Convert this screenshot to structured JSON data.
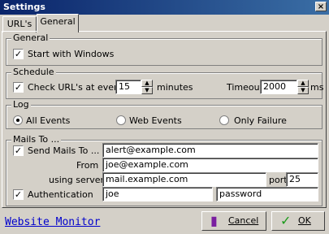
{
  "window": {
    "title": "Settings",
    "close_glyph": "×"
  },
  "tabs": [
    {
      "label": "URL's"
    },
    {
      "label": "General"
    }
  ],
  "general": {
    "legend": "General",
    "start_with_windows": {
      "label": "Start with Windows",
      "checked": true
    }
  },
  "schedule": {
    "legend": "Schedule",
    "check_label": "Check URL's at every",
    "check_checked": true,
    "interval": "15",
    "interval_unit": "minutes",
    "timeout_label": "Timeout",
    "timeout": "2000",
    "timeout_unit": "ms"
  },
  "log": {
    "legend": "Log",
    "options": [
      {
        "label": "All Events",
        "selected": true
      },
      {
        "label": "Web Events",
        "selected": false
      },
      {
        "label": "Only Failure",
        "selected": false
      }
    ]
  },
  "mails": {
    "legend": "Mails To ...",
    "send_label": "Send Mails To ...",
    "send_checked": true,
    "to": "alert@example.com",
    "from_label": "From",
    "from": "joe@example.com",
    "server_label": "using server",
    "server": "mail.example.com",
    "port_label": "port",
    "port": "25",
    "auth_label": "Authentication",
    "auth_checked": true,
    "user": "joe",
    "password": "password"
  },
  "footer": {
    "link": "Website Monitor",
    "cancel": "Cancel",
    "ok": "OK"
  },
  "icons": {
    "check": "✓",
    "up": "▲",
    "down": "▼"
  }
}
